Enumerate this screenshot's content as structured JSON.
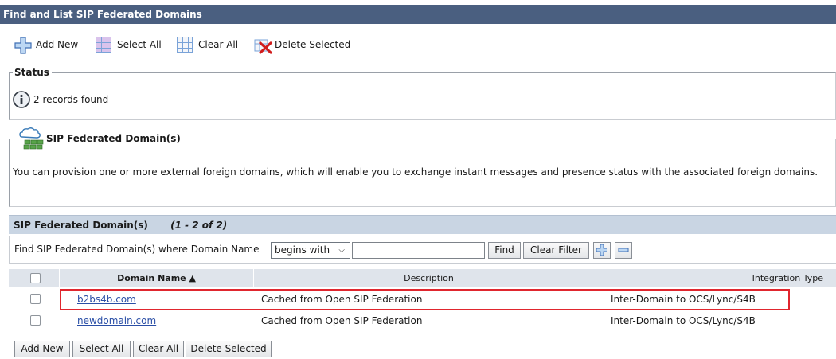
{
  "page": {
    "title": "Find and List SIP Federated Domains"
  },
  "toolbar": {
    "add_new": "Add New",
    "select_all": "Select All",
    "clear_all": "Clear All",
    "delete_selected": "Delete Selected"
  },
  "status": {
    "legend": "Status",
    "message": "2 records found"
  },
  "info": {
    "legend": "SIP Federated Domain(s)",
    "text": "You can provision one or more external foreign domains, which will enable you to exchange instant messages and presence status with the associated foreign domains."
  },
  "list": {
    "title": "SIP Federated Domain(s)",
    "range": "(1 - 2 of 2)",
    "filter": {
      "prefix": "Find SIP Federated Domain(s) where Domain Name",
      "operator": "begins with",
      "value": "",
      "find_label": "Find",
      "clear_filter_label": "Clear Filter"
    },
    "columns": {
      "domain": "Domain Name ▲",
      "description": "Description",
      "integration": "Integration Type"
    },
    "rows": [
      {
        "domain": "b2bs4b.com",
        "description": "Cached from Open SIP Federation",
        "integration": "Inter-Domain to OCS/Lync/S4B",
        "highlighted": true
      },
      {
        "domain": "newdomain.com",
        "description": "Cached from Open SIP Federation",
        "integration": "Inter-Domain to OCS/Lync/S4B",
        "highlighted": false
      }
    ]
  },
  "bottom": {
    "add_new": "Add New",
    "select_all": "Select All",
    "clear_all": "Clear All",
    "delete_selected": "Delete Selected"
  },
  "colors": {
    "title_bar": "#4a5f80",
    "list_header": "#c9d5e3",
    "highlight": "#e0262e",
    "link": "#2a4ea6"
  }
}
